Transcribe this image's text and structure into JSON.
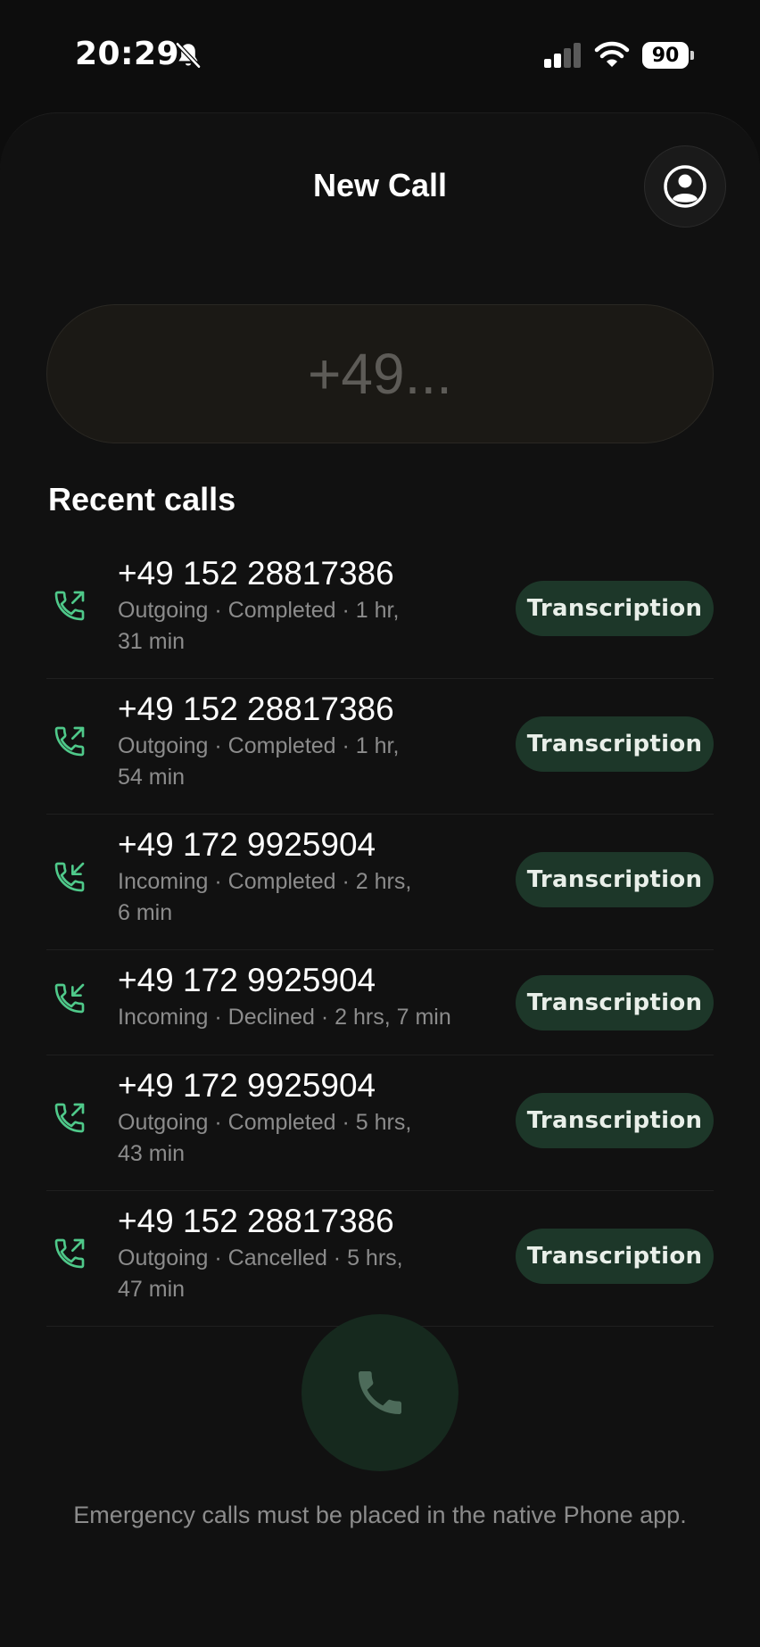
{
  "status_bar": {
    "time": "20:29",
    "battery": "90",
    "icons": [
      "bell-slash-icon",
      "signal-icon",
      "wifi-icon",
      "battery-icon"
    ]
  },
  "header": {
    "title": "New Call",
    "profile_icon": "person-circle-icon"
  },
  "dial_input": {
    "placeholder": "+49...",
    "value": ""
  },
  "recent": {
    "title": "Recent calls",
    "calls": [
      {
        "number": "+49 152 28817386",
        "meta_line1": "Outgoing · Completed · 1 hr,",
        "meta_line2": "31 min",
        "direction": "outgoing",
        "button": "Transcription"
      },
      {
        "number": "+49 152 28817386",
        "meta_line1": "Outgoing · Completed · 1 hr,",
        "meta_line2": "54 min",
        "direction": "outgoing",
        "button": "Transcription"
      },
      {
        "number": "+49 172 9925904",
        "meta_line1": "Incoming · Completed · 2 hrs,",
        "meta_line2": "6 min",
        "direction": "incoming",
        "button": "Transcription"
      },
      {
        "number": "+49 172 9925904",
        "meta_line1": "Incoming · Declined · 2 hrs, 7 min",
        "meta_line2": "",
        "direction": "incoming",
        "button": "Transcription"
      },
      {
        "number": "+49 172 9925904",
        "meta_line1": "Outgoing · Completed · 5 hrs,",
        "meta_line2": "43 min",
        "direction": "outgoing",
        "button": "Transcription"
      },
      {
        "number": "+49 152 28817386",
        "meta_line1": "Outgoing · Cancelled · 5 hrs,",
        "meta_line2": "47 min",
        "direction": "outgoing",
        "button": "Transcription"
      }
    ]
  },
  "call_button_icon": "phone-icon",
  "footer": "Emergency calls must be placed in the native Phone app.",
  "colors": {
    "background": "#0d0d0d",
    "sheet": "#111111",
    "accent_green": "#4fc98a",
    "transcription_button": "#1d3729",
    "call_button": "#16291e",
    "muted_text": "#8c8c8c"
  }
}
